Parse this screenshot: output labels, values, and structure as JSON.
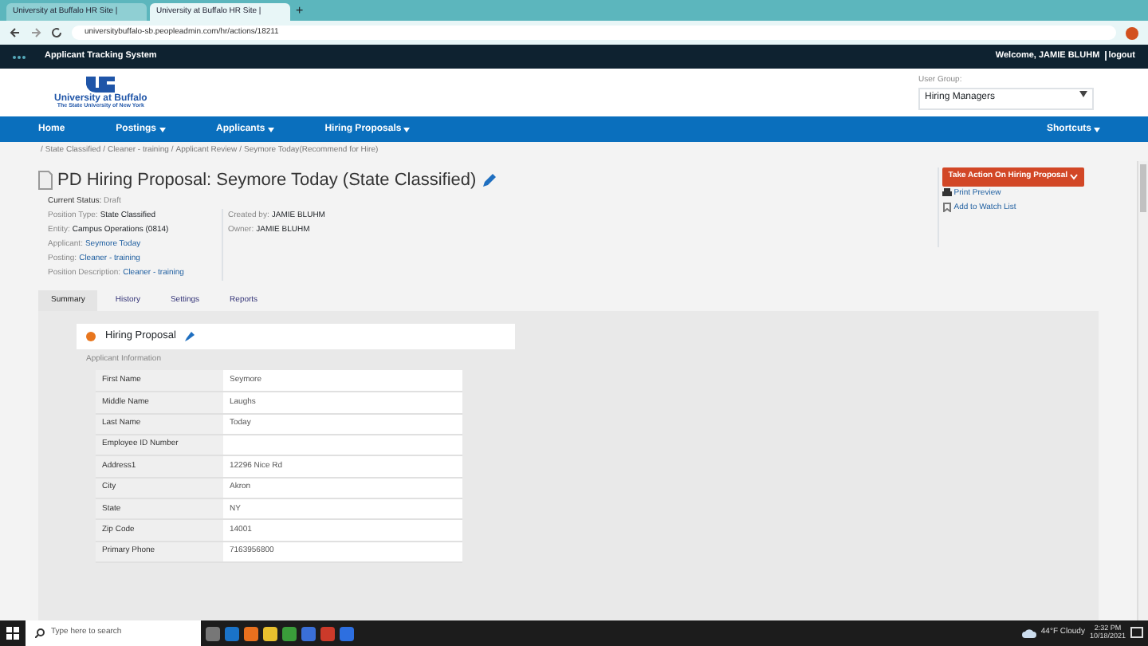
{
  "browser": {
    "tabs": [
      {
        "title": "University at Buffalo HR Site |",
        "selected": false
      },
      {
        "title": "University at Buffalo HR Site |",
        "selected": true
      }
    ],
    "new_tab": "+",
    "url": "universitybuffalo-sb.peopleadmin.com/hr/actions/18211"
  },
  "app_bar": {
    "title": "Applicant Tracking System",
    "welcome": "Welcome, JAMIE BLUHM",
    "logout": "logout"
  },
  "header": {
    "logo_name": "University at Buffalo",
    "logo_tagline": "The State University of New York",
    "user_group_label": "User Group:",
    "user_group": "Hiring Managers"
  },
  "nav": {
    "items": [
      {
        "label": "Home",
        "dropdown": false
      },
      {
        "label": "Postings",
        "dropdown": true
      },
      {
        "label": "Applicants",
        "dropdown": true
      },
      {
        "label": "Hiring Proposals",
        "dropdown": true
      }
    ],
    "shortcuts": "Shortcuts"
  },
  "breadcrumb": {
    "separator": "/",
    "links": [
      "State Classified",
      "Cleaner - training",
      "Applicant Review",
      "Seymore Today"
    ],
    "note": "(Recommend for Hire)"
  },
  "proposal": {
    "title": "PD Hiring Proposal: Seymore Today (State Classified)",
    "status_label": "Current Status:",
    "status": "Draft",
    "details_left": [
      {
        "label": "Position Type:",
        "value": "State Classified",
        "link": false
      },
      {
        "label": "Entity:",
        "value": "Campus Operations (0814)",
        "link": false
      },
      {
        "label": "Applicant:",
        "value": "Seymore Today",
        "link": true
      },
      {
        "label": "Posting:",
        "value": "Cleaner - training",
        "link": true
      },
      {
        "label": "Position Description:",
        "value": "Cleaner - training",
        "link": true
      }
    ],
    "details_right": [
      {
        "label": "Created by:",
        "value": "JAMIE BLUHM",
        "link": false
      },
      {
        "label": "Owner:",
        "value": "JAMIE BLUHM",
        "link": false
      }
    ],
    "action_button": "Take Action On Hiring Proposal",
    "side_links": [
      {
        "kind": "print",
        "label": "Print Preview"
      },
      {
        "kind": "watch",
        "label": "Add to Watch List"
      }
    ]
  },
  "tabs": [
    {
      "label": "Summary",
      "selected": true
    },
    {
      "label": "History",
      "selected": false
    },
    {
      "label": "Settings",
      "selected": false
    },
    {
      "label": "Reports",
      "selected": false
    }
  ],
  "section": {
    "title": "Hiring Proposal",
    "subtitle": "Applicant Information",
    "rows": [
      {
        "label": "First Name",
        "value": "Seymore"
      },
      {
        "label": "Middle Name",
        "value": "Laughs"
      },
      {
        "label": "Last Name",
        "value": "Today"
      },
      {
        "label": "Employee ID Number",
        "value": ""
      },
      {
        "label": "Address1",
        "value": "12296 Nice Rd"
      },
      {
        "label": "City",
        "value": "Akron"
      },
      {
        "label": "State",
        "value": "NY"
      },
      {
        "label": "Zip Code",
        "value": "14001"
      },
      {
        "label": "Primary Phone",
        "value": "7163956800"
      }
    ]
  },
  "taskbar": {
    "search_placeholder": "Type here to search",
    "weather": "44°F  Cloudy",
    "time": "2:32 PM",
    "date": "10/18/2021"
  }
}
